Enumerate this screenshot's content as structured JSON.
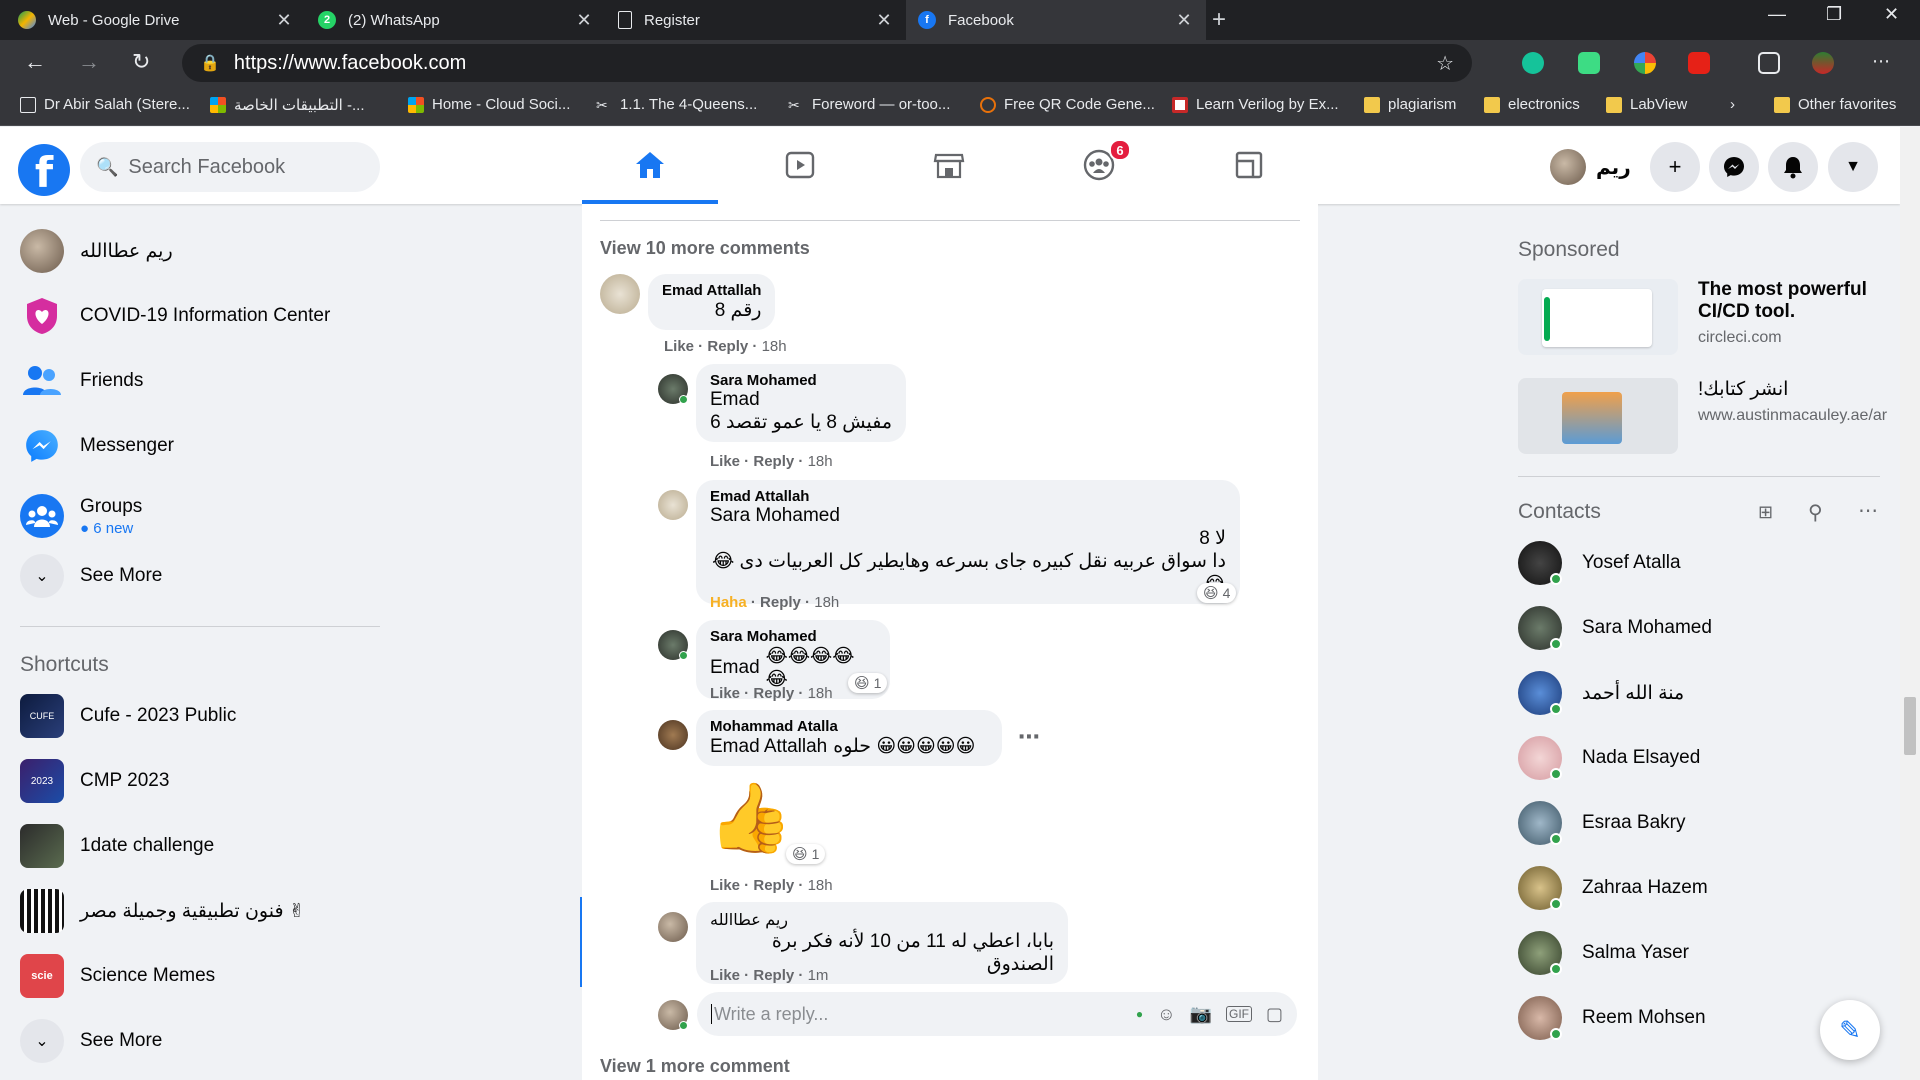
{
  "browser": {
    "tabs": [
      {
        "title": "Web - Google Drive",
        "active": false
      },
      {
        "title": "(2) WhatsApp",
        "active": false
      },
      {
        "title": "Register",
        "active": false
      },
      {
        "title": "Facebook",
        "active": true
      }
    ],
    "url": "https://www.facebook.com",
    "bookmarks": [
      "Dr Abir Salah (Stere...",
      "التطبيقات الخاصة -...",
      "Home - Cloud Soci...",
      "1.1. The 4-Queens...",
      "Foreword — or-too...",
      "Free QR Code Gene...",
      "Learn Verilog by Ex...",
      "plagiarism",
      "electronics",
      "LabView",
      "Other favorites"
    ]
  },
  "header": {
    "logo": "f",
    "search_placeholder": "Search Facebook",
    "groups_badge": "6",
    "profile_name": "ريم"
  },
  "sidebar": {
    "items": [
      {
        "label": "ريم عطاالله"
      },
      {
        "label": "COVID-19 Information Center"
      },
      {
        "label": "Friends"
      },
      {
        "label": "Messenger"
      },
      {
        "label": "Groups",
        "sub": "6 new"
      },
      {
        "label": "See More"
      }
    ],
    "shortcuts_title": "Shortcuts",
    "shortcuts": [
      {
        "label": "Cufe - 2023 Public"
      },
      {
        "label": "CMP 2023"
      },
      {
        "label": "1date challenge"
      },
      {
        "label": "فنون تطبيقية وجميلة مصر ✌"
      },
      {
        "label": "Science Memes"
      },
      {
        "label": "See More"
      }
    ]
  },
  "feed": {
    "view_more": "View 10 more comments",
    "view_more_bottom": "View 1 more comment",
    "reply_placeholder": "Write a reply...",
    "comments": [
      {
        "author": "Emad Attallah",
        "mention": "",
        "lines": [
          "رقم 8"
        ],
        "actions": [
          "Like",
          "Reply"
        ],
        "time": "18h"
      },
      {
        "author": "Sara Mohamed",
        "mention": "Emad",
        "lines": [
          "مفيش 8 يا عمو تقصد 6"
        ],
        "actions": [
          "Like",
          "Reply"
        ],
        "time": "18h"
      },
      {
        "author": "Emad Attallah",
        "mention": "Sara Mohamed",
        "lines": [
          "لا 8",
          "دا سواق عربيه نقل كبيره جاى بسرعه وهايطير كل العربيات دى 😂😂"
        ],
        "actions": [
          "Haha",
          "Reply"
        ],
        "time": "18h",
        "reaction_count": "4"
      },
      {
        "author": "Sara Mohamed",
        "mention": "Emad",
        "lines": [
          "😂😂😂😂😂"
        ],
        "actions": [
          "Like",
          "Reply"
        ],
        "time": "18h",
        "reaction_count": "1"
      },
      {
        "author": "Mohammad Atalla",
        "mention": "Emad Attallah",
        "lines": [
          "حلوه 😀😀😀😀😀"
        ],
        "actions": [
          "Like",
          "Reply"
        ],
        "time": "18h",
        "reaction_count": "1",
        "sticker": "👍"
      },
      {
        "author": "ريم عطاالله",
        "mention": "",
        "lines": [
          "بابا، اعطي له 11 من 10 لأنه فكر برة الصندوق"
        ],
        "actions": [
          "Like",
          "Reply"
        ],
        "time": "1m"
      }
    ]
  },
  "right": {
    "sponsored_title": "Sponsored",
    "ads": [
      {
        "title": "The most powerful CI/CD tool.",
        "url": "circleci.com"
      },
      {
        "title": "انشر كتابك!",
        "url": "www.austinmacauley.ae/ar"
      }
    ],
    "contacts_title": "Contacts",
    "contacts": [
      "Yosef Atalla",
      "Sara Mohamed",
      "منة الله أحمد",
      "Nada Elsayed",
      "Esraa Bakry",
      "Zahraa Hazem",
      "Salma Yaser",
      "Reem Mohsen"
    ]
  }
}
